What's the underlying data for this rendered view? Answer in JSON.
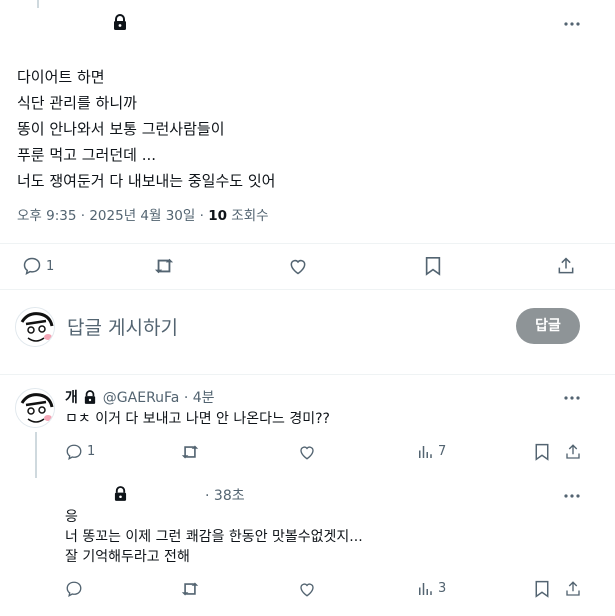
{
  "main_tweet": {
    "lines": [
      "다이어트 하면",
      "식단 관리를 하니까",
      "똥이 안나와서 보통 그런사람들이",
      "푸룬 먹고 그러던데 ...",
      "너도 쟁여둔거 다 내보내는 중일수도 잇어"
    ],
    "time": "오후 9:35",
    "date": "2025년 4월 30일",
    "views_count": "10",
    "views_label": "조회수",
    "reply_count": "1"
  },
  "composer": {
    "placeholder": "답글 게시하기",
    "button_label": "답글"
  },
  "reply1": {
    "display_name": "개",
    "handle": "@GAERuFa",
    "time": "4분",
    "text": "ㅁㅊ 이거 다 보내고 나면 안 나온다느 경미??",
    "reply_count": "1",
    "views_count": "7"
  },
  "reply2": {
    "time": "38초",
    "lines": [
      "응",
      "너 똥꼬는 이제 그런 쾌감을 한동안 맛볼수없겟지...",
      "잘 기억해두라고 전해"
    ],
    "views_count": "3"
  },
  "separator": "·"
}
